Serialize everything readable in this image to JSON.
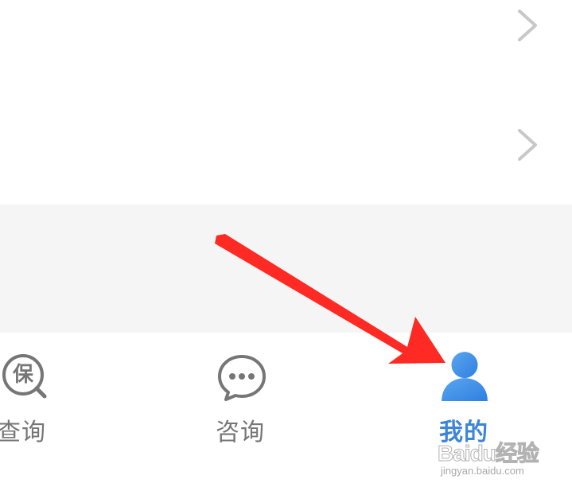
{
  "list": {
    "rows": [
      {
        "edge_glyph": "&gt;",
        "chevron": "chevron-right-icon"
      },
      {
        "edge_glyph": "",
        "chevron": "chevron-right-icon"
      }
    ]
  },
  "tabbar": {
    "tabs": [
      {
        "label": "查询",
        "icon": "bao-search-icon",
        "icon_text": "保",
        "active": false
      },
      {
        "label": "咨询",
        "icon": "chat-bubble-icon",
        "active": false
      },
      {
        "label": "我的",
        "icon": "user-icon",
        "active": true
      }
    ]
  },
  "colors": {
    "active": "#3d85d8",
    "inactive": "#767676",
    "band": "#f5f5f5",
    "annotation_arrow": "#ff2a24"
  },
  "watermark": {
    "brand": "Baidu经验",
    "url": "jingyan.baidu.com"
  }
}
